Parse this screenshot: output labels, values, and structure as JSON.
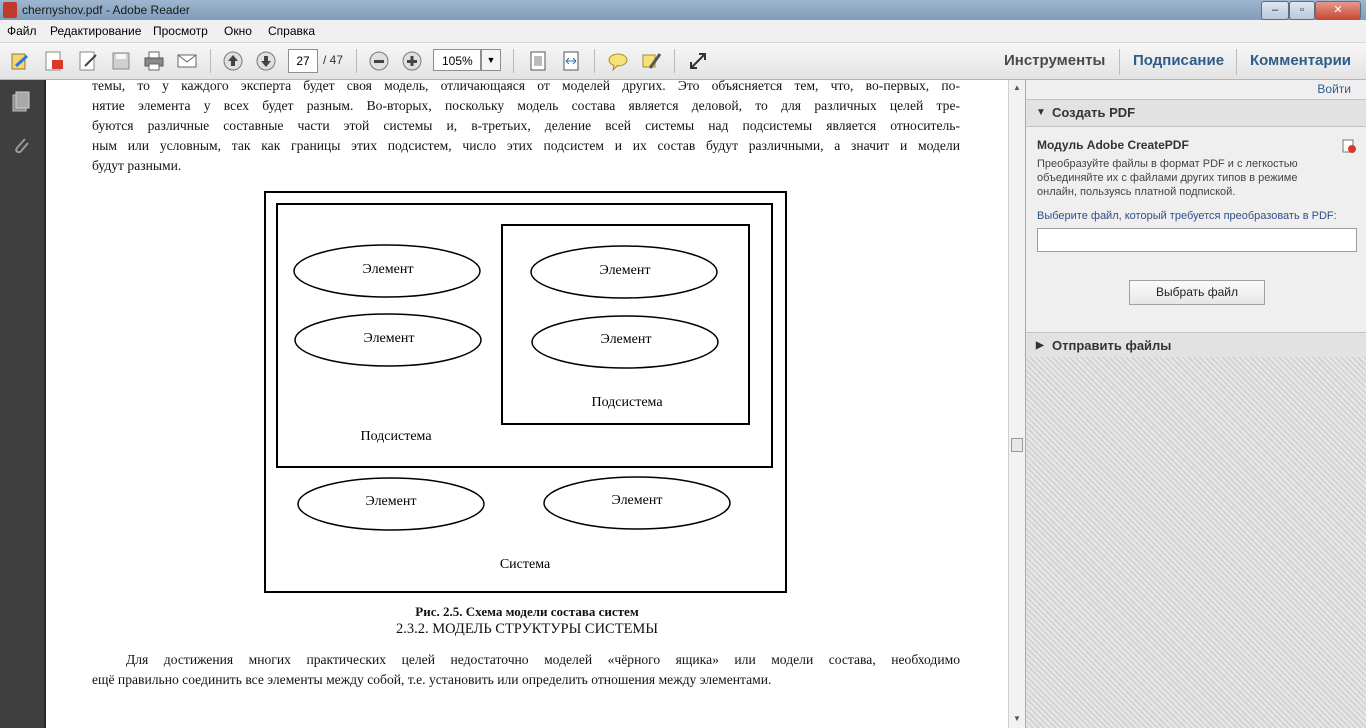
{
  "window": {
    "title": "chernyshov.pdf - Adobe Reader"
  },
  "menu": [
    "Файл",
    "Редактирование",
    "Просмотр",
    "Окно",
    "Справка"
  ],
  "toolbar": {
    "page_current": "27",
    "page_total": "/ 47",
    "zoom": "105%",
    "right_tabs": [
      "Инструменты",
      "Подписание",
      "Комментарии"
    ]
  },
  "document": {
    "intro_lines": [
      "темы, то у каждого эксперта будет своя модель, отличающаяся от моделей других. Это объясняется тем, что, во-первых, по-",
      "нятие элемента у всех будет разным. Во-вторых, поскольку модель состава является деловой, то для различных целей тре-",
      "буются различные составные части этой системы и, в-третьих, деление всей системы над подсистемы является относитель-",
      "ным или условным, так как границы этих подсистем, число этих подсистем и их состав будут различными, а значит и модели",
      "будут разными."
    ],
    "diagram": {
      "element_label": "Элемент",
      "subsystem_label": "Подсистема",
      "system_label": "Система"
    },
    "figure_caption": "Рис. 2.5. Схема модели состава систем",
    "section_heading": "2.3.2. МОДЕЛЬ СТРУКТУРЫ СИСТЕМЫ",
    "body_lines": [
      "Для достижения многих практических целей недостаточно моделей «чёрного ящика» или модели состава, необходимо",
      "ещё правильно соединить все элементы между собой, т.е. установить или определить отношения между элементами."
    ]
  },
  "right_panel": {
    "signin": "Войти",
    "create_pdf_header": "Создать PDF",
    "module_title": "Модуль Adobe CreatePDF",
    "module_desc_lines": [
      "Преобразуйте файлы в формат PDF и с легкостью",
      "объединяйте их с файлами других типов в режиме",
      "онлайн, пользуясь платной подпиской."
    ],
    "choose_prompt": "Выберите файл, который требуется преобразовать в PDF:",
    "choose_button": "Выбрать файл",
    "send_files_header": "Отправить файлы"
  }
}
